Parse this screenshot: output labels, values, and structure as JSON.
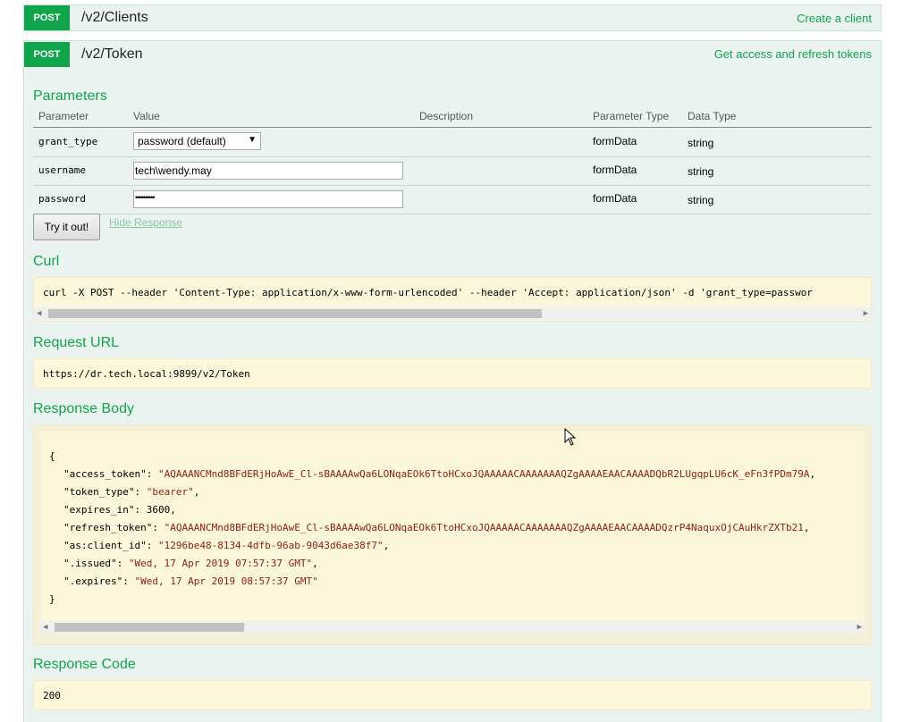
{
  "operations": [
    {
      "method": "POST",
      "path": "/v2/Clients",
      "summary": "Create a client"
    },
    {
      "method": "POST",
      "path": "/v2/Token",
      "summary": "Get access and refresh tokens"
    }
  ],
  "parameters": {
    "title": "Parameters",
    "headers": [
      "Parameter",
      "Value",
      "Description",
      "Parameter Type",
      "Data Type"
    ],
    "rows": [
      {
        "name": "grant_type",
        "value": "password (default)",
        "param_type": "formData",
        "data_type": "string"
      },
      {
        "name": "username",
        "value": "tech\\wendy.may",
        "param_type": "formData",
        "data_type": "string"
      },
      {
        "name": "password",
        "value": "••••••••••",
        "param_type": "formData",
        "data_type": "string"
      }
    ]
  },
  "actions": {
    "try_label": "Try it out!",
    "hide_label": "Hide Response"
  },
  "curl": {
    "title": "Curl",
    "command": "curl -X POST --header 'Content-Type: application/x-www-form-urlencoded' --header 'Accept: application/json' -d 'grant_type=passwor"
  },
  "request_url": {
    "title": "Request URL",
    "value": "https://dr.tech.local:9899/v2/Token"
  },
  "response_body": {
    "title": "Response Body",
    "open": "{",
    "close": "}",
    "entries": [
      {
        "key": "\"access_token\"",
        "value": "\"AQAAANCMnd8BFdERjHoAwE_Cl-sBAAAAwQa6LONqaEOk6TtoHCxoJQAAAAACAAAAAAAQZgAAAAEAACAAAADQbR2LUgqpLU6cK_eFn3fPDm79A",
        "str": true,
        "comma": true
      },
      {
        "key": "\"token_type\"",
        "value": "\"bearer\"",
        "str": true,
        "comma": true
      },
      {
        "key": "\"expires_in\"",
        "value": "3600",
        "str": false,
        "comma": true
      },
      {
        "key": "\"refresh_token\"",
        "value": "\"AQAAANCMnd8BFdERjHoAwE_Cl-sBAAAAwQa6LONqaEOk6TtoHCxoJQAAAAACAAAAAAAQZgAAAAEAACAAAADQzrP4NaquxOjCAuHkrZXTb21",
        "str": true,
        "comma": true
      },
      {
        "key": "\"as:client_id\"",
        "value": "\"1296be48-8134-4dfb-96ab-9043d6ae38f7\"",
        "str": true,
        "comma": true
      },
      {
        "key": "\".issued\"",
        "value": "\"Wed, 17 Apr 2019 07:57:37 GMT\"",
        "str": true,
        "comma": true
      },
      {
        "key": "\".expires\"",
        "value": "\"Wed, 17 Apr 2019 08:57:37 GMT\"",
        "str": true,
        "comma": false
      }
    ]
  },
  "response_code": {
    "title": "Response Code",
    "value": "200"
  },
  "colors": {
    "accent": "#10a54a",
    "panel": "#ebf3f0",
    "code_bg": "#fcf6db",
    "string": "#8a1f11"
  }
}
